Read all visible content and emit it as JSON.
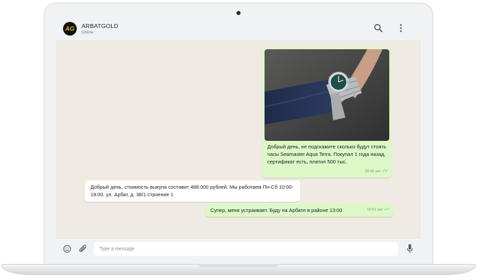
{
  "contact": {
    "avatar_text": "AG",
    "name": "ARBATGOLD",
    "status": "Online"
  },
  "messages": [
    {
      "direction": "outgoing",
      "has_photo": true,
      "photo_subject": "wristwatch-on-wrist",
      "text": "Добрый день, не подскажите сколько будут стоять часы Seamaster Aqua Terra. Покупал 1 года назад, сертификат есть, платил 500 тыс.",
      "time": "10:49 am",
      "status": "read"
    },
    {
      "direction": "incoming",
      "text": "Добрый день, стоимость выкупа составит 488.000 рублей. Мы работаем Пн-Сб 10:00-19:00. ул. Арбат, д. 38/1 строение 1"
    },
    {
      "direction": "outgoing",
      "text": "Супер, меня устраивает. Буду на Арбате в районе 13:00",
      "time": "10:51 am",
      "status": "read"
    }
  ],
  "composer": {
    "placeholder": "Type a message"
  },
  "icons": {
    "search": "search-icon",
    "menu": "more-vertical-icon",
    "emoji": "emoji-icon",
    "attach": "paperclip-icon",
    "mic": "microphone-icon",
    "read": "double-check-icon"
  },
  "colors": {
    "outgoing_bubble": "#dcf8c6",
    "incoming_bubble": "#ffffff",
    "chat_background": "#efeae2",
    "read_tick": "#4fb6ec",
    "avatar_text": "#d9a932"
  }
}
